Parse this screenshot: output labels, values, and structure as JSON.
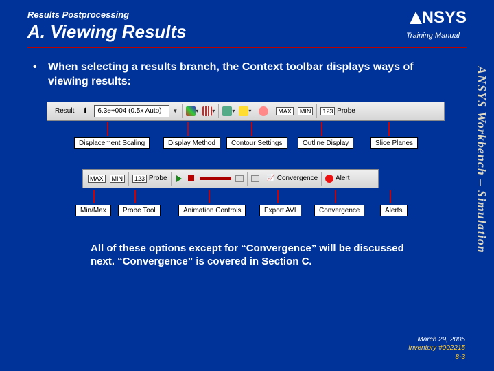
{
  "header": {
    "breadcrumb": "Results Postprocessing",
    "title": "A.  Viewing Results",
    "training_manual": "Training Manual",
    "logo_text": "NSYS"
  },
  "side_text": "ANSYS Workbench – Simulation",
  "bullet": {
    "marker": "•",
    "text": "When selecting a results branch, the Context toolbar displays ways of viewing results:"
  },
  "toolbar1": {
    "result_label": "Result",
    "scale_text": "6.3e+004 (0.5x Auto)",
    "max_label": "MAX",
    "min_label": "MIN",
    "probe_label": "Probe"
  },
  "callouts1": {
    "c1": "Displacement Scaling",
    "c2": "Display Method",
    "c3": "Contour Settings",
    "c4": "Outline Display",
    "c5": "Slice Planes"
  },
  "toolbar2": {
    "max_label": "MAX",
    "min_label": "MIN",
    "probe_label": "Probe",
    "conv_label": "Convergence",
    "alert_label": "Alert"
  },
  "callouts2": {
    "c1": "Min/Max",
    "c2": "Probe Tool",
    "c3": "Animation Controls",
    "c4": "Export AVI",
    "c5": "Convergence",
    "c6": "Alerts"
  },
  "closing": "All of these options except for “Convergence” will be discussed next.  “Convergence” is covered in Section C.",
  "footer": {
    "date": "March 29, 2005",
    "inv": "Inventory #002215",
    "page": "8-3"
  }
}
